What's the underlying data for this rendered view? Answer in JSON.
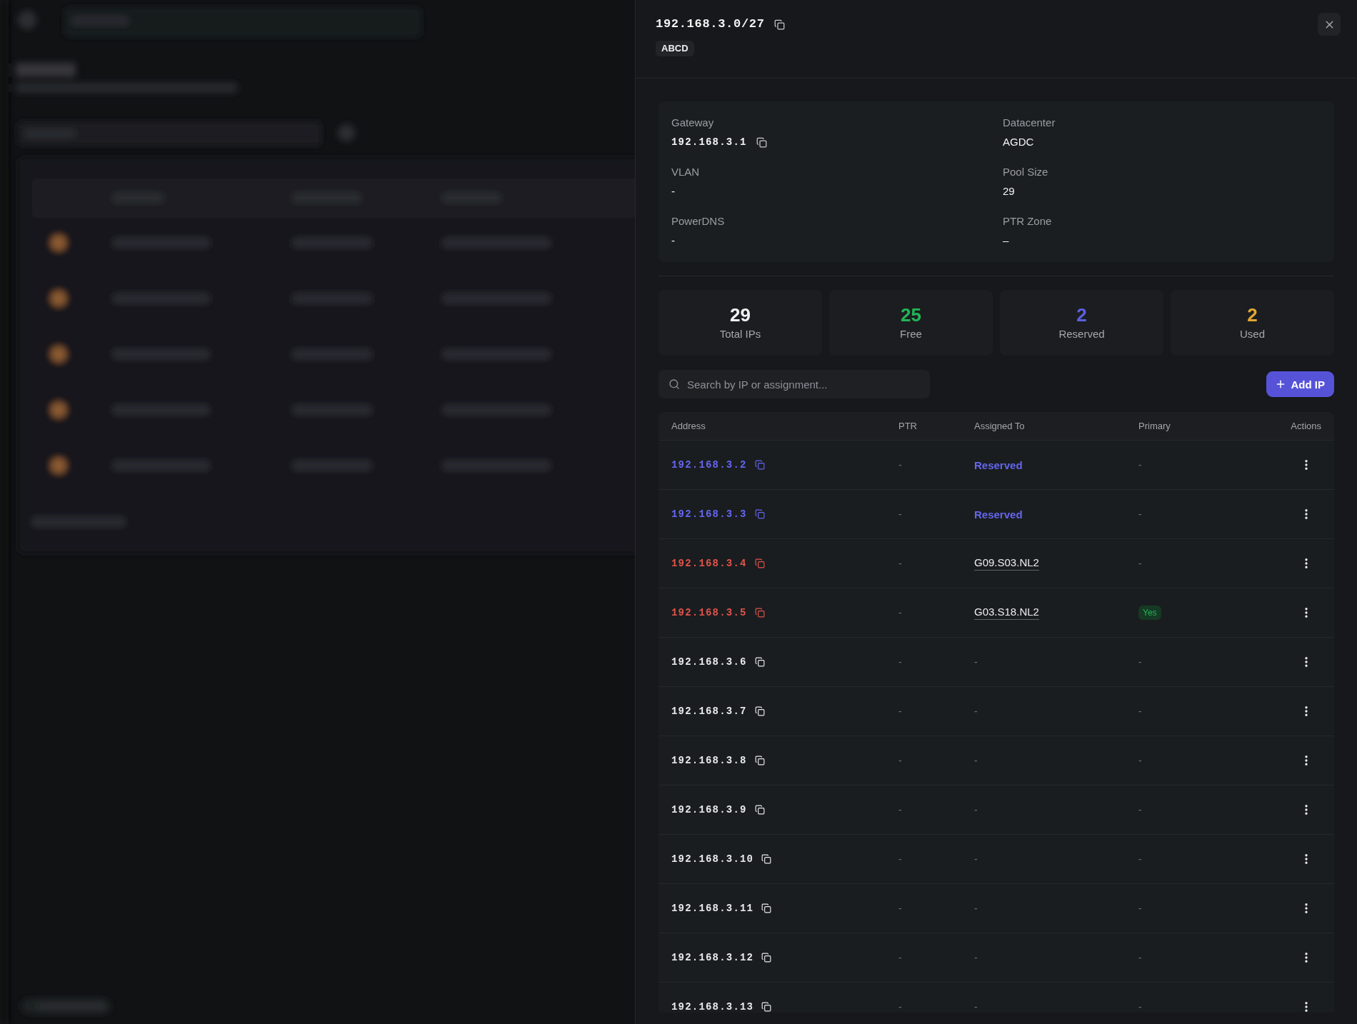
{
  "drawer": {
    "title": "192.168.3.0/27",
    "badge": "ABCD",
    "details": [
      {
        "label": "Gateway",
        "value": "192.168.3.1",
        "kind": "address"
      },
      {
        "label": "Datacenter",
        "value": "AGDC",
        "kind": "text"
      },
      {
        "label": "VLAN",
        "value": "-",
        "kind": "text"
      },
      {
        "label": "Pool Size",
        "value": "29",
        "kind": "text"
      },
      {
        "label": "PowerDNS",
        "value": "-",
        "kind": "text"
      },
      {
        "label": "PTR Zone",
        "value": "–",
        "kind": "text"
      }
    ],
    "stats": [
      {
        "value": "29",
        "label": "Total IPs",
        "color": "#f2f2f3"
      },
      {
        "value": "25",
        "label": "Free",
        "color": "#22b455"
      },
      {
        "value": "2",
        "label": "Reserved",
        "color": "#5d5fe0"
      },
      {
        "value": "2",
        "label": "Used",
        "color": "#e2a633"
      }
    ],
    "search": {
      "placeholder": "Search by IP or assignment..."
    },
    "add_button": {
      "label": "Add IP"
    },
    "table": {
      "columns": [
        "Address",
        "PTR",
        "Assigned To",
        "Primary",
        "Actions"
      ],
      "rows": [
        {
          "address": "192.168.3.2",
          "kind": "reserved",
          "ptr": "-",
          "assigned_to": "Reserved",
          "primary": false,
          "primary_label": "-"
        },
        {
          "address": "192.168.3.3",
          "kind": "reserved",
          "ptr": "-",
          "assigned_to": "Reserved",
          "primary": false,
          "primary_label": "-"
        },
        {
          "address": "192.168.3.4",
          "kind": "used",
          "ptr": "-",
          "assigned_to": "G09.S03.NL2",
          "primary": false,
          "primary_label": "-"
        },
        {
          "address": "192.168.3.5",
          "kind": "used",
          "ptr": "-",
          "assigned_to": "G03.S18.NL2",
          "primary": true,
          "primary_label": "Yes"
        },
        {
          "address": "192.168.3.6",
          "kind": "free",
          "ptr": "-",
          "assigned_to": "-",
          "primary": false,
          "primary_label": "-"
        },
        {
          "address": "192.168.3.7",
          "kind": "free",
          "ptr": "-",
          "assigned_to": "-",
          "primary": false,
          "primary_label": "-"
        },
        {
          "address": "192.168.3.8",
          "kind": "free",
          "ptr": "-",
          "assigned_to": "-",
          "primary": false,
          "primary_label": "-"
        },
        {
          "address": "192.168.3.9",
          "kind": "free",
          "ptr": "-",
          "assigned_to": "-",
          "primary": false,
          "primary_label": "-"
        },
        {
          "address": "192.168.3.10",
          "kind": "free",
          "ptr": "-",
          "assigned_to": "-",
          "primary": false,
          "primary_label": "-"
        },
        {
          "address": "192.168.3.11",
          "kind": "free",
          "ptr": "-",
          "assigned_to": "-",
          "primary": false,
          "primary_label": "-"
        },
        {
          "address": "192.168.3.12",
          "kind": "free",
          "ptr": "-",
          "assigned_to": "-",
          "primary": false,
          "primary_label": "-"
        },
        {
          "address": "192.168.3.13",
          "kind": "free",
          "ptr": "-",
          "assigned_to": "-",
          "primary": false,
          "primary_label": "-"
        }
      ]
    }
  }
}
